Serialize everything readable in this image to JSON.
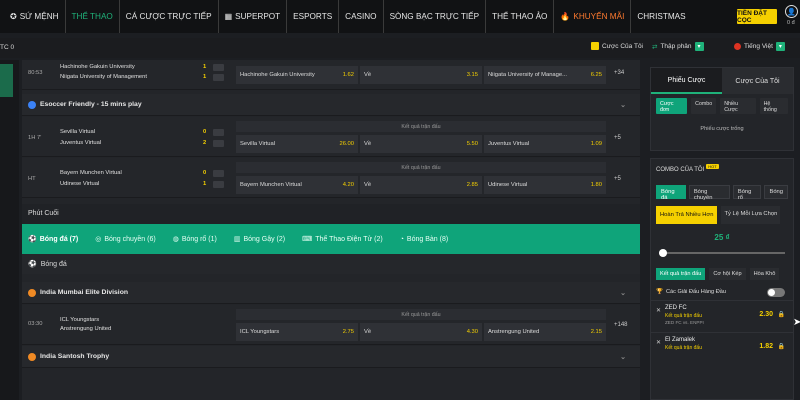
{
  "nav": {
    "items": [
      {
        "label": "SỨ MỆNH",
        "icon": "star-icon"
      },
      {
        "label": "THỂ THAO",
        "active": true
      },
      {
        "label": "CÁ CƯỢC TRỰC TIẾP"
      },
      {
        "label": "SUPERPOT",
        "icon": "superpot-icon"
      },
      {
        "label": "ESPORTS"
      },
      {
        "label": "CASINO"
      },
      {
        "label": "SÒNG BẠC TRỰC TIẾP"
      },
      {
        "label": "THỂ THAO ẢO"
      },
      {
        "label": "KHUYẾN MÃI",
        "icon": "fire-icon",
        "color": "#ff7a2f"
      },
      {
        "label": "CHRISTMAS"
      }
    ],
    "deposit_label": "TIỀN ĐẶT CỌC",
    "balance": "0 đ"
  },
  "subbar": {
    "left_text": "TC 0",
    "bet_slip_label": "Cược Của Tôi",
    "odds_format": "Thập phân",
    "language": "Tiếng Việt"
  },
  "matches_top": [
    {
      "time": "80:53",
      "home": "Hachinohe Gakuin University",
      "away": "Niigata University of Management",
      "score_home": "1",
      "score_away": "1",
      "odd1_team": "Hachinohe Gakuin University",
      "odd1": "1.62",
      "draw_label": "Về",
      "odd2": "3.15",
      "odd3_team": "Niigata University of Manage...",
      "odd3": "6.25",
      "more": "+34"
    }
  ],
  "virtual_section": {
    "title": "Esoccer Friendly - 15 mins play",
    "market_header": "Kết quả trận đấu",
    "matches": [
      {
        "time": "1H 7'",
        "home": "Sevilla Virtual",
        "away": "Juventus Virtual",
        "score_home": "0",
        "score_away": "2",
        "odd1_team": "Sevilla Virtual",
        "odd1": "26.00",
        "draw_label": "Về",
        "odd2": "5.50",
        "odd3_team": "Juventus Virtual",
        "odd3": "1.09",
        "more": "+5"
      },
      {
        "time": "HT",
        "home": "Bayern Munchen Virtual",
        "away": "Udinese Virtual",
        "score_home": "0",
        "score_away": "1",
        "odd1_team": "Bayern Munchen Virtual",
        "odd1": "4.20",
        "draw_label": "Về",
        "odd2": "2.85",
        "odd3_team": "Udinese Virtual",
        "odd3": "1.80",
        "more": "+5"
      }
    ]
  },
  "phut_cuoi": "Phút Cuối",
  "sport_tabs": [
    {
      "label": "Bóng đá (7)",
      "icon": "football-icon",
      "active": true
    },
    {
      "label": "Bóng chuyền (6)",
      "icon": "volleyball-icon"
    },
    {
      "label": "Bóng rổ (1)",
      "icon": "basketball-icon"
    },
    {
      "label": "Bóng Gậy (2)",
      "icon": "bat-icon"
    },
    {
      "label": "Thể Thao Điện Tử (2)",
      "icon": "gamepad-icon"
    },
    {
      "label": "Bóng Bàn (8)",
      "icon": "pingpong-icon"
    }
  ],
  "football_label": "Bóng đá",
  "league_mumbai": {
    "title": "India Mumbai Elite Division",
    "market_header": "Kết quả trận đấu",
    "match": {
      "time": "03:30",
      "home": "ICL Youngstars",
      "away": "Anstrengung United",
      "odd1_team": "ICL Youngstars",
      "odd1": "2.75",
      "draw_label": "Về",
      "odd2": "4.30",
      "odd3_team": "Anstrengung United",
      "odd3": "2.15",
      "more": "+148"
    }
  },
  "league_santosh": {
    "title": "India Santosh Trophy"
  },
  "sidebar": {
    "tab_betslip": "Phiếu Cược",
    "tab_mybets": "Cược Của Tôi",
    "subtabs": [
      "Cược đơn",
      "Combo",
      "Nhiều Cược",
      "Hệ thống"
    ],
    "empty_text": "Phiếu cược trống",
    "combo_title": "COMBO CỦA TÔI",
    "hot_badge": "HOT",
    "sports": [
      "Bóng đá",
      "Bóng chuyền",
      "Bóng rổ",
      "Bóng"
    ],
    "choices": [
      "Hoàn Trả Nhiều Hơn",
      "Tỷ Lệ Mỗi Lựa Chọn"
    ],
    "stake": "25 ₫",
    "slider_level": 0,
    "bet_types": [
      "Kết quả trận đấu",
      "Cơ hội Kép",
      "Hòa Khô"
    ],
    "toggle_label": "Các Giải Đấu Hàng Đầu",
    "selections": [
      {
        "team": "ZED FC",
        "market": "Kết quả trận đấu",
        "match": "ZED FC vs. ENPPI",
        "odd": "2.30"
      },
      {
        "team": "El Zamalek",
        "market": "Kết quả trận đấu",
        "match": "",
        "odd": "1.82"
      }
    ]
  }
}
